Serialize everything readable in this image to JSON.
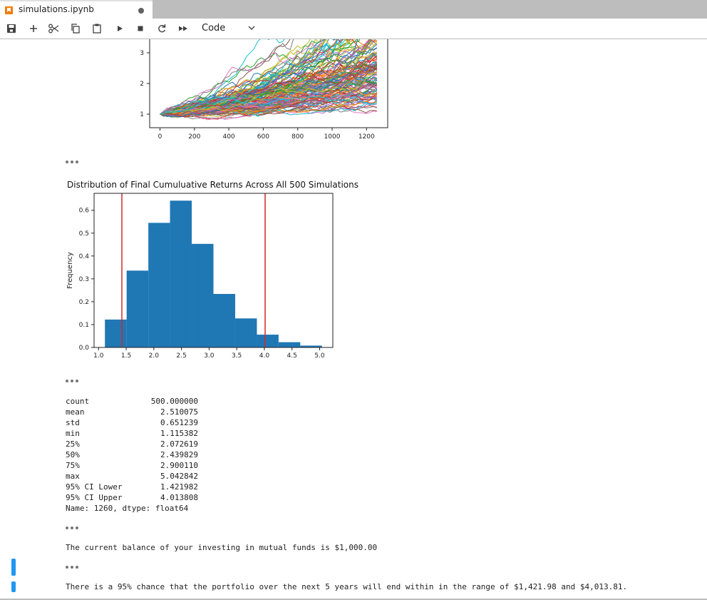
{
  "tab": {
    "title": "simulations.ipynb"
  },
  "toolbar": {
    "cell_type": "Code"
  },
  "chart_data": [
    {
      "type": "line",
      "title": "",
      "xlabel": "",
      "ylabel": "",
      "x_ticks": [
        0,
        200,
        400,
        600,
        800,
        1000,
        1200
      ],
      "y_ticks": [
        1,
        2,
        3
      ],
      "xlim": [
        -60,
        1323
      ],
      "series_count": 500,
      "note_visible": "cropped at top"
    },
    {
      "type": "bar",
      "title": "Distribution of Final Cumuluative Returns Across All 500 Simulations",
      "ylabel": "Frequency",
      "xlabel": "",
      "bin_edges": [
        1.115,
        1.508,
        1.901,
        2.293,
        2.686,
        3.079,
        3.472,
        3.865,
        4.257,
        4.65,
        5.043
      ],
      "values": [
        0.122,
        0.336,
        0.545,
        0.642,
        0.453,
        0.234,
        0.127,
        0.056,
        0.023,
        0.008
      ],
      "vlines": [
        1.421982,
        4.013808
      ],
      "vline_color": "#d62728",
      "bar_color": "#1f77b4",
      "x_ticks": [
        "1.0",
        "1.5",
        "2.0",
        "2.5",
        "3.0",
        "3.5",
        "4.0",
        "4.5",
        "5.0"
      ],
      "y_ticks": [
        "0.0",
        "0.1",
        "0.2",
        "0.3",
        "0.4",
        "0.5",
        "0.6"
      ],
      "xlim": [
        0.919,
        5.239
      ],
      "ylim": [
        0,
        0.674
      ]
    }
  ],
  "stats": {
    "rows": [
      {
        "label": "count",
        "value": "500.000000"
      },
      {
        "label": "mean",
        "value": "2.510075"
      },
      {
        "label": "std",
        "value": "0.651239"
      },
      {
        "label": "min",
        "value": "1.115382"
      },
      {
        "label": "25%",
        "value": "2.072619"
      },
      {
        "label": "50%",
        "value": "2.439829"
      },
      {
        "label": "75%",
        "value": "2.900110"
      },
      {
        "label": "max",
        "value": "5.042842"
      },
      {
        "label": "95% CI Lower",
        "value": "1.421982"
      },
      {
        "label": "95% CI Upper",
        "value": "4.013808"
      }
    ],
    "footer": "Name: 1260, dtype: float64"
  },
  "outputs": {
    "balance": "The current balance of your investing in mutual funds is $1,000.00",
    "range": "There is a 95% chance that the portfolio over the next 5 years will end within in the range of $1,421.98 and $4,013.81."
  }
}
